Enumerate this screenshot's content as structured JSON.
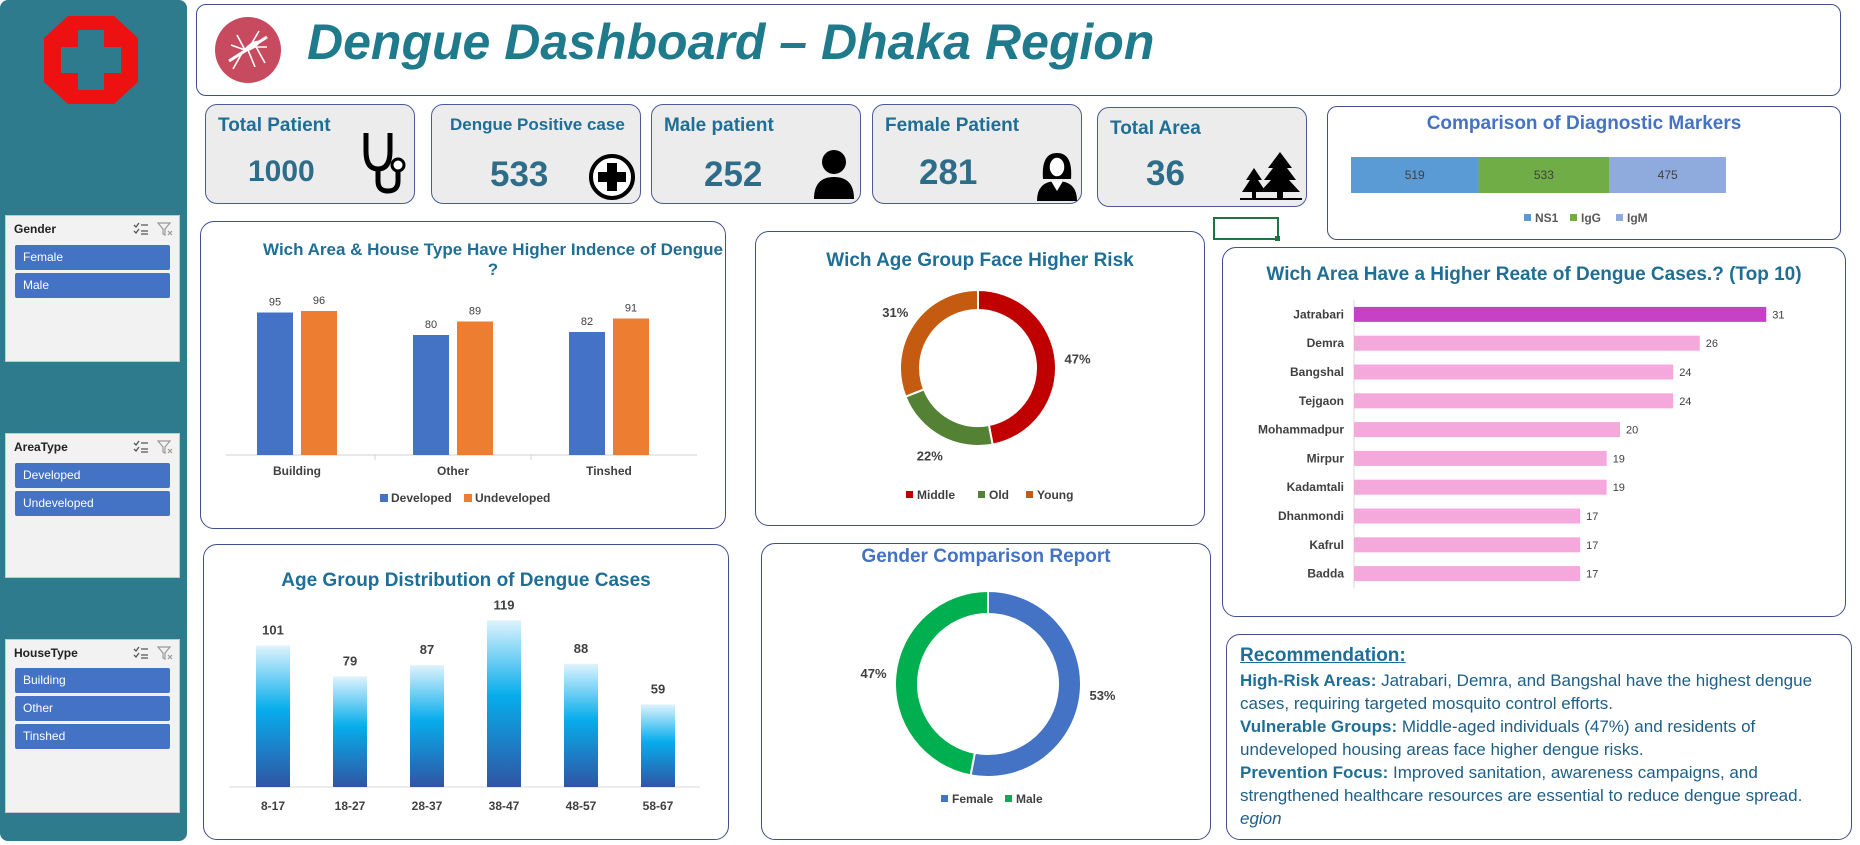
{
  "header": {
    "title": "Dengue Dashboard – Dhaka Region"
  },
  "slicers": {
    "gender": {
      "title": "Gender",
      "items": [
        "Female",
        "Male"
      ]
    },
    "area_type": {
      "title": "AreaType",
      "items": [
        "Developed",
        "Undeveloped"
      ]
    },
    "house_type": {
      "title": "HouseType",
      "items": [
        "Building",
        "Other",
        "Tinshed"
      ]
    }
  },
  "kpis": {
    "total_patient": {
      "label": "Total Patient",
      "value": "1000",
      "icon": "stethoscope-icon"
    },
    "dengue_positive": {
      "label": "Dengue Positive case",
      "value": "533",
      "icon": "plus-circle-icon"
    },
    "male_patient": {
      "label": "Male patient",
      "value": "252",
      "icon": "male-person-icon"
    },
    "female_patient": {
      "label": "Female Patient",
      "value": "281",
      "icon": "female-person-icon"
    },
    "total_area": {
      "label": "Total Area",
      "value": "36",
      "icon": "trees-icon"
    }
  },
  "colors": {
    "developed": "#4472c4",
    "undeveloped": "#ed7d31",
    "middle": "#c00000",
    "old": "#548235",
    "young": "#c55a11",
    "female": "#4472c4",
    "male": "#00b050",
    "ns1": "#5b9bd5",
    "igg": "#70ad47",
    "igm": "#8faadc",
    "top_bar": "#c741c7",
    "other_bars": "#f4a8dc"
  },
  "chart_data": [
    {
      "id": "diagnostic_markers",
      "type": "bar",
      "orientation": "stacked-horizontal",
      "title": "Comparison of Diagnostic Markers",
      "series": [
        {
          "name": "NS1",
          "values": [
            519
          ]
        },
        {
          "name": "IgG",
          "values": [
            533
          ]
        },
        {
          "name": "IgM",
          "values": [
            475
          ]
        }
      ],
      "legend": "bottom"
    },
    {
      "id": "area_house_type",
      "type": "bar",
      "title": "Wich Area & House Type Have Higher Indence of Dengue ?",
      "categories": [
        "Building",
        "Other",
        "Tinshed"
      ],
      "series": [
        {
          "name": "Developed",
          "values": [
            95,
            80,
            82
          ]
        },
        {
          "name": "Undeveloped",
          "values": [
            96,
            89,
            91
          ]
        }
      ],
      "ylim": [
        0,
        110
      ],
      "legend": "bottom"
    },
    {
      "id": "age_group_risk",
      "type": "pie",
      "style": "donut",
      "title": "Wich Age Group Face Higher Risk",
      "labels": [
        "Middle",
        "Old",
        "Young"
      ],
      "values": [
        47,
        22,
        31
      ],
      "unit": "%",
      "legend": "bottom"
    },
    {
      "id": "top10_areas",
      "type": "bar",
      "orientation": "horizontal",
      "title": "Wich Area Have a Higher Reate of Dengue Cases.? (Top 10)",
      "categories": [
        "Jatrabari",
        "Demra",
        "Bangshal",
        "Tejgaon",
        "Mohammadpur",
        "Mirpur",
        "Kadamtali",
        "Dhanmondi",
        "Kafrul",
        "Badda"
      ],
      "values": [
        31,
        26,
        24,
        24,
        20,
        19,
        19,
        17,
        17,
        17
      ],
      "xlim": [
        0,
        32
      ]
    },
    {
      "id": "age_group_distribution",
      "type": "bar",
      "title": "Age Group Distribution of Dengue Cases",
      "categories": [
        "8-17",
        "18-27",
        "28-37",
        "38-47",
        "48-57",
        "58-67"
      ],
      "values": [
        101,
        79,
        87,
        119,
        88,
        59
      ],
      "ylim": [
        0,
        125
      ]
    },
    {
      "id": "gender_comparison",
      "type": "pie",
      "style": "donut",
      "title": "Gender Comparison Report",
      "labels": [
        "Female",
        "Male"
      ],
      "values": [
        53,
        47
      ],
      "unit": "%",
      "legend": "bottom"
    }
  ],
  "recommendation": {
    "heading": "Recommendation:",
    "items": [
      {
        "label": "High-Risk Areas:",
        "text": " Jatrabari, Demra, and Bangshal have the highest dengue cases, requiring targeted mosquito control efforts."
      },
      {
        "label": "Vulnerable Groups:",
        "text": " Middle-aged individuals (47%) and residents of undeveloped housing areas face higher dengue risks."
      },
      {
        "label": "Prevention Focus:",
        "text": " Improved sanitation, awareness campaigns, and strengthened healthcare resources are essential to reduce dengue spread."
      }
    ],
    "trailing": "egion"
  }
}
